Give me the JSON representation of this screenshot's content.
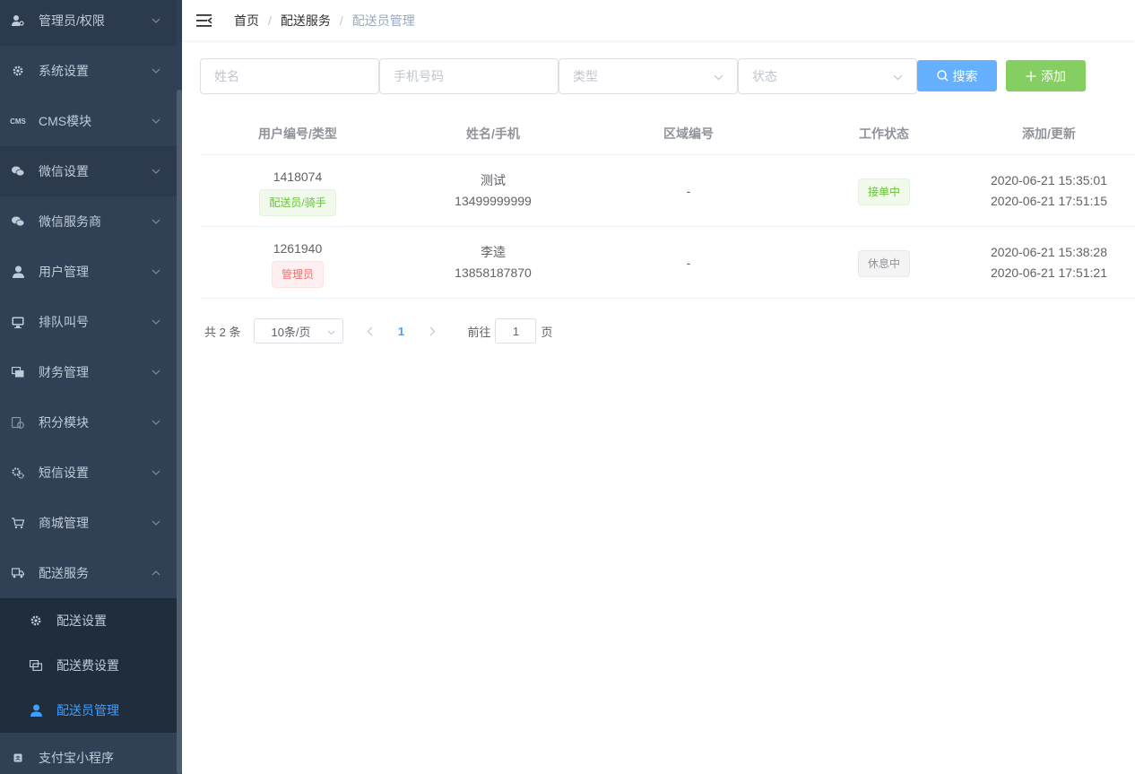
{
  "sidebar": {
    "items": [
      {
        "label": "管理员/权限",
        "icon": "user-key-icon"
      },
      {
        "label": "系统设置",
        "icon": "gear-icon"
      },
      {
        "label": "CMS模块",
        "icon": "cms-icon",
        "icon_text": "CMS"
      },
      {
        "label": "微信设置",
        "icon": "wechat-icon"
      },
      {
        "label": "微信服务商",
        "icon": "wechat-icon"
      },
      {
        "label": "用户管理",
        "icon": "user-icon"
      },
      {
        "label": "排队叫号",
        "icon": "monitor-icon"
      },
      {
        "label": "财务管理",
        "icon": "money-icon"
      },
      {
        "label": "积分模块",
        "icon": "points-icon"
      },
      {
        "label": "短信设置",
        "icon": "sms-gear-icon"
      },
      {
        "label": "商城管理",
        "icon": "cart-icon"
      },
      {
        "label": "配送服务",
        "icon": "truck-icon"
      }
    ],
    "submenu": [
      {
        "label": "配送设置",
        "icon": "gear-icon"
      },
      {
        "label": "配送费设置",
        "icon": "money-icon"
      },
      {
        "label": "配送员管理",
        "icon": "user-icon"
      }
    ],
    "bottom_item": {
      "label": "支付宝小程序",
      "icon": "alipay-icon"
    }
  },
  "breadcrumb": [
    "首页",
    "配送服务",
    "配送员管理"
  ],
  "filters": {
    "name_placeholder": "姓名",
    "phone_placeholder": "手机号码",
    "type_placeholder": "类型",
    "status_placeholder": "状态"
  },
  "buttons": {
    "search": "搜索",
    "add": "添加"
  },
  "table": {
    "headers": [
      "用户编号/类型",
      "姓名/手机",
      "区域编号",
      "工作状态",
      "添加/更新"
    ],
    "rows": [
      {
        "id": "1418074",
        "type": "配送员/骑手",
        "type_style": "success",
        "name": "测试",
        "phone": "13499999999",
        "area": "-",
        "status": "接单中",
        "status_style": "success",
        "added": "2020-06-21 15:35:01",
        "updated": "2020-06-21 17:51:15"
      },
      {
        "id": "1261940",
        "type": "管理员",
        "type_style": "danger",
        "name": "李逵",
        "phone": "13858187870",
        "area": "-",
        "status": "休息中",
        "status_style": "info",
        "added": "2020-06-21 15:38:28",
        "updated": "2020-06-21 17:51:21"
      }
    ]
  },
  "pagination": {
    "total_text": "共 2 条",
    "page_size": "10条/页",
    "current_page": "1",
    "goto_label": "前往",
    "goto_value": "1",
    "page_suffix": "页"
  },
  "colors": {
    "sidebar_bg": "#304156",
    "active": "#409eff",
    "search_btn": "#66b1ff",
    "add_btn": "#85ce61"
  }
}
